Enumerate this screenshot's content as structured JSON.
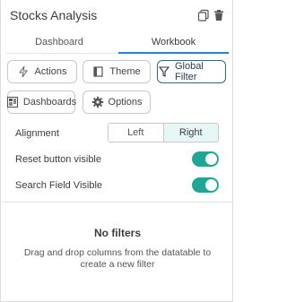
{
  "header": {
    "title": "Stocks Analysis",
    "icons": [
      "copy-icon",
      "trash-icon"
    ]
  },
  "tabs": [
    {
      "label": "Dashboard",
      "active": false
    },
    {
      "label": "Workbook",
      "active": true
    }
  ],
  "buttons": {
    "actions": "Actions",
    "theme": "Theme",
    "global_filter": "Global Filter",
    "dashboards": "Dashboards",
    "options": "Options"
  },
  "settings": {
    "alignment": {
      "label": "Alignment",
      "options": [
        "Left",
        "Right"
      ],
      "selected": "Right"
    },
    "reset_button_visible": {
      "label": "Reset button visible",
      "value": true
    },
    "search_field_visible": {
      "label": "Search Field Visible",
      "value": true
    }
  },
  "empty_state": {
    "title": "No filters",
    "description": "Drag and drop columns from the datatable to create a new filter"
  },
  "colors": {
    "accent": "#2c7fd1",
    "toggle_on": "#1fa795",
    "selected_segment": "#e6f7f6",
    "active_button_border": "#2e6b7a"
  }
}
